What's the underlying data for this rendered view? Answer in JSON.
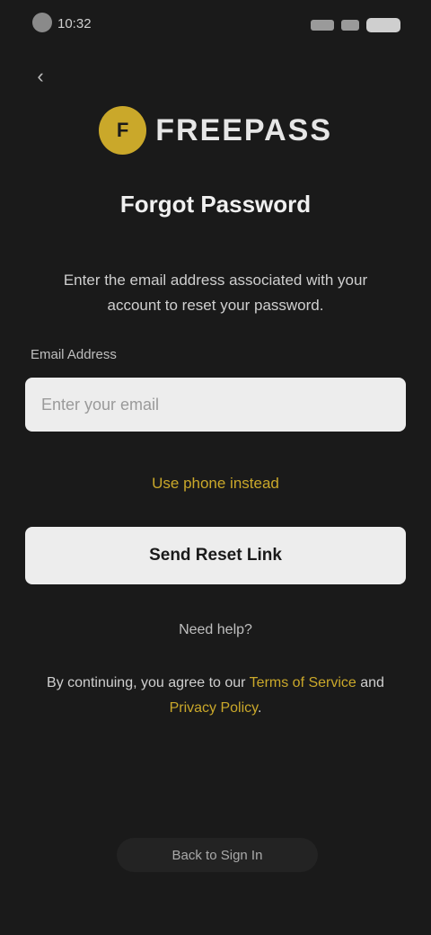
{
  "status": {
    "time": "10:32"
  },
  "app": {
    "logo_text": "FREEPASS",
    "logo_mark": "F"
  },
  "screen": {
    "title": "Forgot Password",
    "description": "Enter the email address associated with your account to reset your password."
  },
  "form": {
    "email_label": "Email Address",
    "email_placeholder": "Enter your email",
    "alt_link": "Use phone instead",
    "submit_label": "Send Reset Link"
  },
  "footer": {
    "or_text": "Need help?",
    "legal_prefix": "By continuing, you agree to our ",
    "terms_link": "Terms of Service",
    "legal_mid": " and ",
    "privacy_link": "Privacy Policy",
    "legal_suffix": ".",
    "pill_text": "Back to Sign In"
  },
  "colors": {
    "background": "#1a1a1a",
    "accent": "#caa82a",
    "button_bg": "#ededed"
  },
  "icons": {
    "back": "chevron-left-icon",
    "signal": "signal-icon",
    "wifi": "wifi-icon",
    "battery": "battery-icon"
  }
}
